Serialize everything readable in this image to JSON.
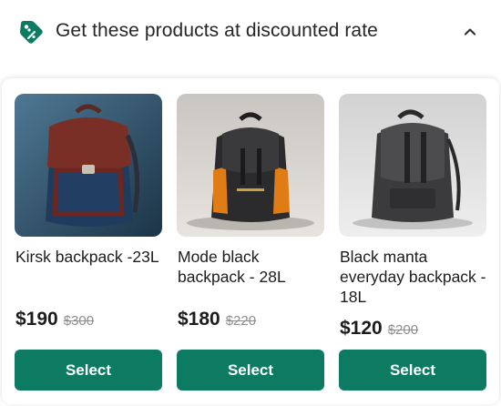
{
  "header": {
    "title": "Get these products at discounted rate",
    "icon": "discount-tag-icon",
    "toggle_icon": "chevron-up-icon",
    "accent_color": "#0d7b62"
  },
  "products": [
    {
      "name": "Kirsk backpack -23L",
      "price": "$190",
      "original_price": "$300",
      "button_label": "Select",
      "image": "red-navy-backpack-photo"
    },
    {
      "name": "Mode black backpack - 28L",
      "price": "$180",
      "original_price": "$220",
      "button_label": "Select",
      "image": "black-orange-backpack-photo"
    },
    {
      "name": "Black manta everyday backpack - 18L",
      "price": "$120",
      "original_price": "$200",
      "button_label": "Select",
      "image": "grey-backpack-photo"
    }
  ]
}
